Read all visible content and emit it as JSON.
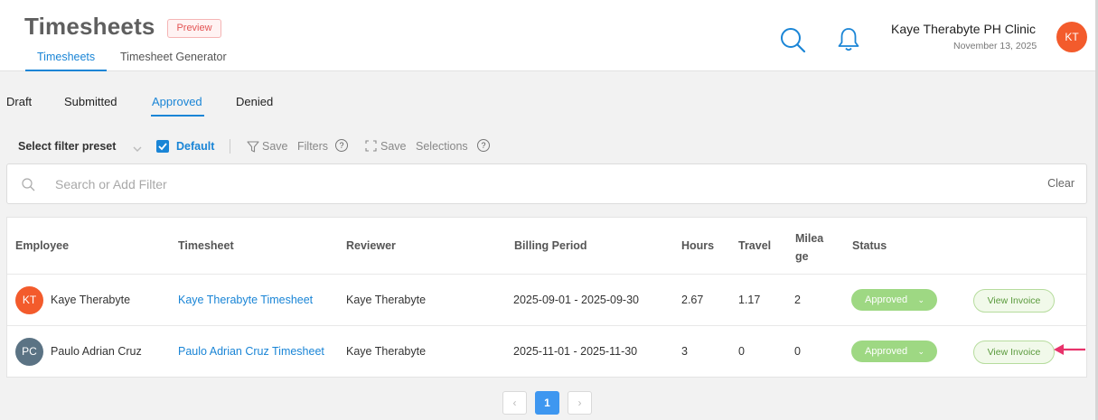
{
  "header": {
    "title": "Timesheets",
    "badge": "Preview",
    "tabs": [
      "Timesheets",
      "Timesheet Generator"
    ],
    "icons": [
      "search-icon",
      "bell-icon"
    ],
    "user": {
      "name": "Kaye Therabyte PH Clinic",
      "date": "November 13, 2025",
      "initials": "KT"
    }
  },
  "status_tabs": [
    "Draft",
    "Submitted",
    "Approved",
    "Denied"
  ],
  "active_status_tab": "Approved",
  "filters": {
    "preset_label": "Select filter preset",
    "default_label": "Default",
    "save_filters": [
      "Save",
      "Filters"
    ],
    "save_selections": [
      "Save",
      "Selections"
    ],
    "help": "?"
  },
  "search": {
    "placeholder": "Search or Add Filter",
    "clear_label": "Clear"
  },
  "table": {
    "columns": [
      "Employee",
      "Timesheet",
      "Reviewer",
      "Billing Period",
      "Hours",
      "Travel",
      "Mileage",
      "Status"
    ],
    "rows": [
      {
        "initials": "KT",
        "avatar_color": "#f35b2c",
        "employee": "Kaye Therabyte",
        "timesheet": "Kaye Therabyte Timesheet",
        "reviewer": "Kaye Therabyte",
        "billing_period": "2025-09-01 - 2025-09-30",
        "hours": "2.67",
        "travel": "1.17",
        "mileage": "2",
        "status": "Approved",
        "action": "View Invoice"
      },
      {
        "initials": "PC",
        "avatar_color": "#5b7384",
        "employee": "Paulo Adrian Cruz",
        "timesheet": "Paulo Adrian Cruz Timesheet",
        "reviewer": "Kaye Therabyte",
        "billing_period": "2025-11-01 - 2025-11-30",
        "hours": "3",
        "travel": "0",
        "mileage": "0",
        "status": "Approved",
        "action": "View Invoice"
      }
    ]
  },
  "pagination": {
    "prev": "‹",
    "current": "1",
    "next": "›"
  },
  "colors": {
    "accent": "#1a85d6",
    "approved": "#9ed883",
    "annotation_arrow": "#e8336b"
  }
}
